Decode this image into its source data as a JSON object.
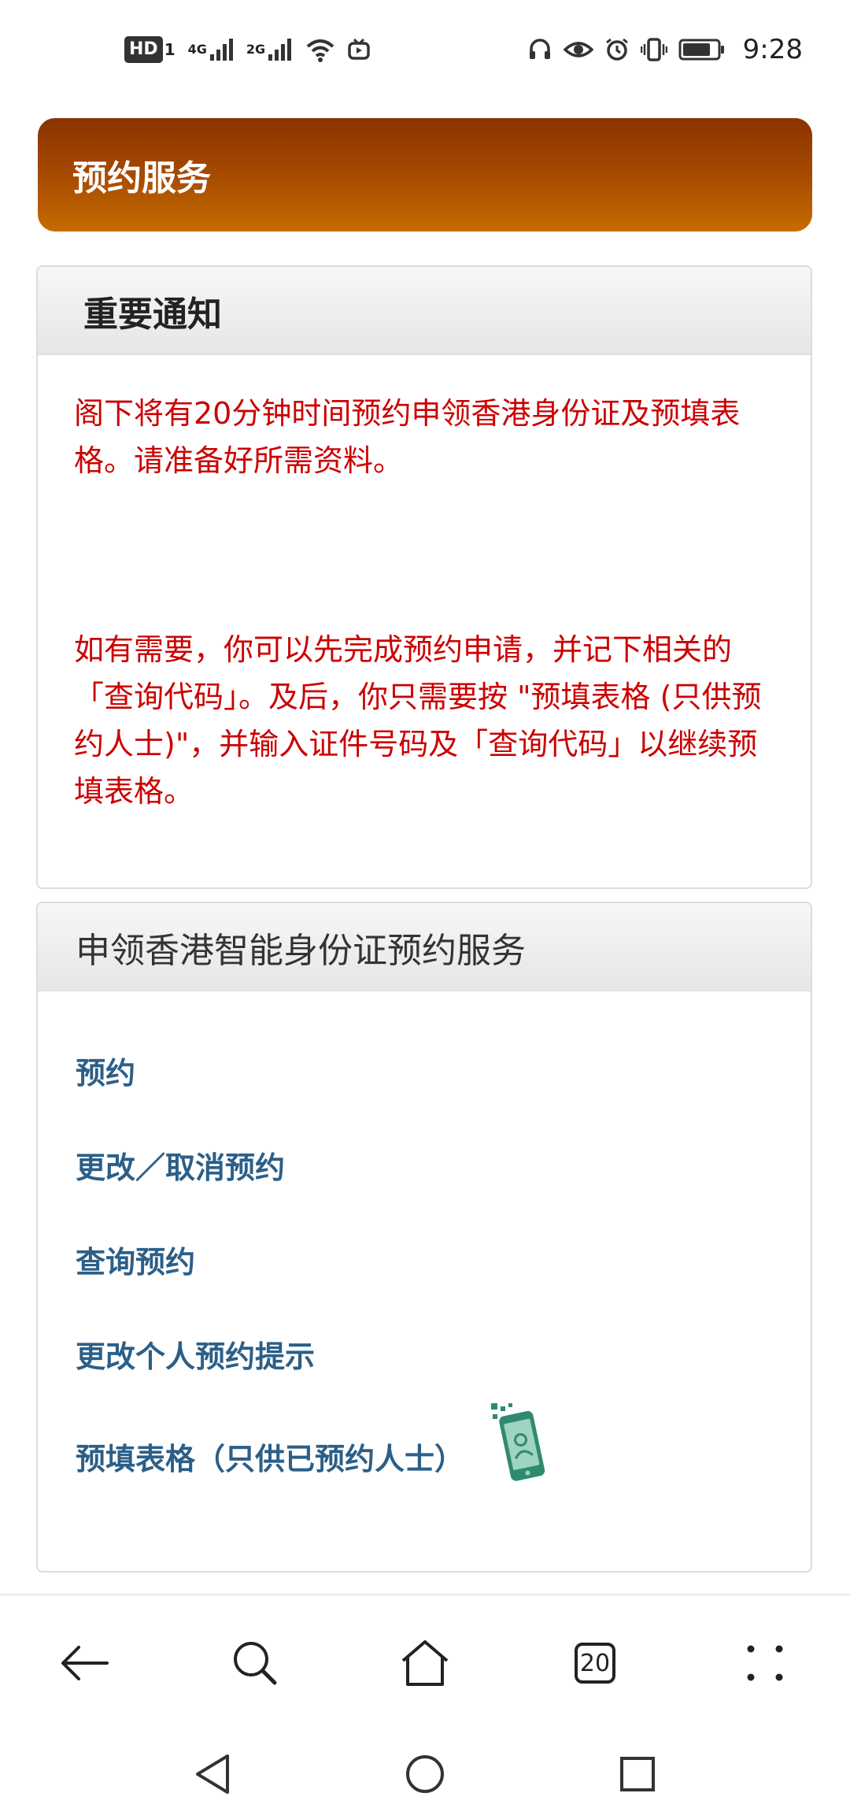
{
  "status_bar": {
    "hd_label": "HD",
    "sim_label": "1",
    "net_1": "4G",
    "net_2": "2G",
    "time": "9:28"
  },
  "header": {
    "title": "预约服务"
  },
  "notice": {
    "title": "重要通知",
    "paragraph_1": "阁下将有20分钟时间预约申领香港身份证及预填表格。请准备好所需资料。",
    "paragraph_2": "如有需要，你可以先完成预约申请，并记下相关的「查询代码」。及后，你只需要按 \"预填表格 (只供预约人士)\"，并输入证件号码及「查询代码」以继续预填表格。"
  },
  "services": {
    "title": "申领香港智能身份证预约服务",
    "items": [
      {
        "label": "预约"
      },
      {
        "label": "更改／取消预约"
      },
      {
        "label": "查询预约"
      },
      {
        "label": "更改个人预约提示"
      },
      {
        "label": "预填表格（只供已预约人士）"
      }
    ]
  },
  "browser_nav": {
    "tab_count": "20"
  },
  "colors": {
    "header_gradient_top": "#8a3300",
    "header_gradient_bottom": "#c66c00",
    "notice_text": "#cc0000",
    "link_text": "#2c5f88",
    "phone_icon": "#2f8a70"
  },
  "icons": [
    "back-arrow-icon",
    "search-icon",
    "home-icon",
    "tabs-icon",
    "more-icon",
    "back-triangle-icon",
    "home-circle-icon",
    "recents-square-icon"
  ]
}
